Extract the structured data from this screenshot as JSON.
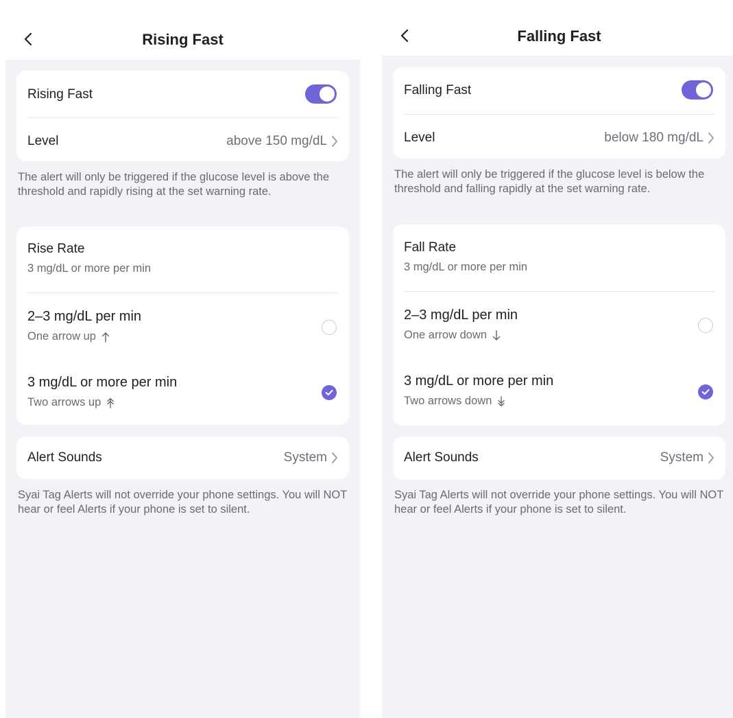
{
  "screens": [
    {
      "title": "Rising Fast",
      "toggle_label": "Rising Fast",
      "toggle_on": true,
      "level_label": "Level",
      "level_value": "above 150 mg/dL",
      "level_note": "The alert will only be triggered if the glucose level is above the threshold and rapidly rising at the set warning rate.",
      "rate_title": "Rise Rate",
      "rate_current": "3 mg/dL or more per min",
      "options": [
        {
          "title": "2–3 mg/dL per min",
          "sub": "One arrow up",
          "icon": "arrow-up-icon",
          "selected": false
        },
        {
          "title": "3 mg/dL or more per min",
          "sub": "Two arrows up",
          "icon": "double-arrow-up-icon",
          "selected": true
        }
      ],
      "sounds_label": "Alert Sounds",
      "sounds_value": "System",
      "sounds_note": "Syai Tag Alerts will not override your phone settings. You will NOT hear or feel Alerts if your phone is set to silent."
    },
    {
      "title": "Falling Fast",
      "toggle_label": "Falling Fast",
      "toggle_on": true,
      "level_label": "Level",
      "level_value": "below 180 mg/dL",
      "level_note": "The alert will only be triggered if the glucose level is below the threshold and falling rapidly at the set warning rate.",
      "rate_title": "Fall Rate",
      "rate_current": "3 mg/dL or more per min",
      "options": [
        {
          "title": "2–3 mg/dL per min",
          "sub": "One arrow down",
          "icon": "arrow-down-icon",
          "selected": false
        },
        {
          "title": "3 mg/dL or more per min",
          "sub": "Two arrows down",
          "icon": "double-arrow-down-icon",
          "selected": true
        }
      ],
      "sounds_label": "Alert Sounds",
      "sounds_value": "System",
      "sounds_note": "Syai Tag Alerts will not override your phone settings. You will NOT hear or feel Alerts if your phone is set to silent."
    }
  ],
  "colors": {
    "accent": "#7065d8",
    "background": "#f2f3f6",
    "card": "#ffffff",
    "text_primary": "#1f1f24",
    "text_secondary": "#6a6a72"
  }
}
